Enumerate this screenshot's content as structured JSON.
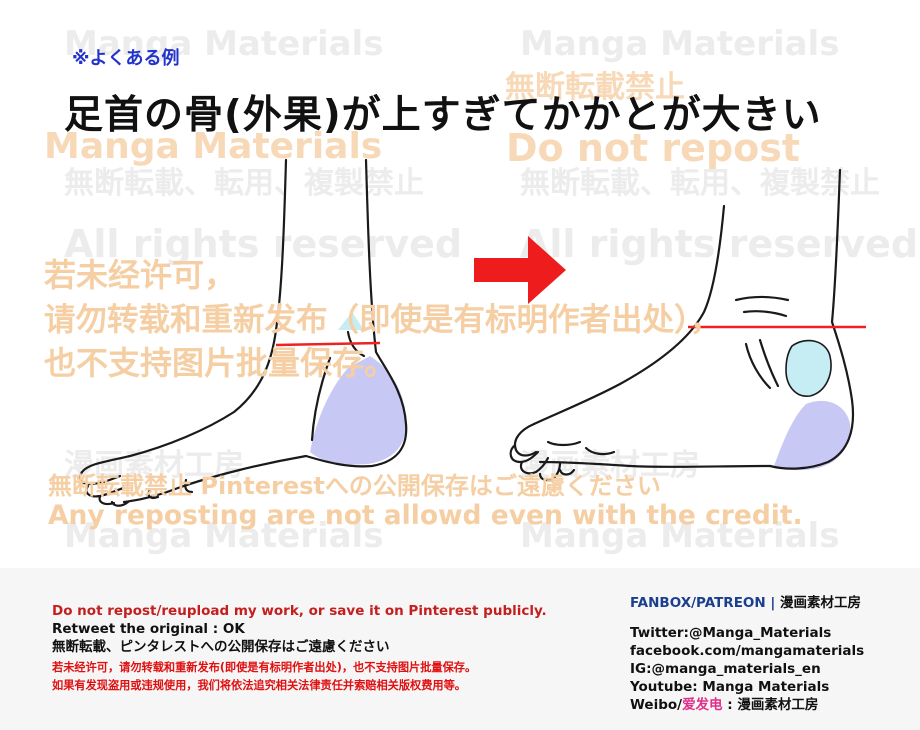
{
  "note": "※よくある例",
  "title": "足首の骨(外果)が上すぎてかかとが大きい",
  "watermarks": {
    "grey": [
      "Manga Materials",
      "Manga Materials",
      "漫画素材工房",
      "無断転載、転用、複製禁止",
      "無断転載、転用、複製禁止",
      "All rights reserved",
      "All rights reserved",
      "漫画素材工房",
      "漫画素材工房",
      "Manga Materials",
      "Manga Materials"
    ],
    "orange": [
      "Manga Materials",
      "無断転載禁止",
      "Do not repost",
      "若未经许可，",
      "请勿转载和重新发布（即使是有标明作者出处），",
      "也不支持图片批量保存。",
      "無断転載禁止 Pinterestへの公開保存はご遠慮ください",
      "Any reposting are not allowd even with the credit."
    ]
  },
  "footer": {
    "line1": "Do not repost/reupload my work, or save it on Pinterest publicly.",
    "line2": "Retweet the original : OK",
    "line3": "無断転載、ピンタレストへの公開保存はご遠慮ください",
    "line4": "若未经许可，请勿转载和重新发布(即使是有标明作者出处)，也不支持图片批量保存。",
    "line5": "如果有发现盗用或违规使用，我们将依法追究相关法律责任并索赔相关版权费用等。",
    "fanbox": "FANBOX/PATREON",
    "fanbox_sep": "|",
    "fanbox_name": "漫画素材工房",
    "twitter": "Twitter:@Manga_Materials",
    "facebook": "facebook.com/mangamaterials",
    "ig": "IG:@manga_materials_en",
    "youtube": "Youtube: Manga Materials",
    "weibo_prefix": "Weibo/",
    "weibo_cn": "爱发电",
    "weibo_suffix": " : 漫画素材工房"
  },
  "colors": {
    "arrow": "#ee1c1c",
    "heel_fill": "#c8c8f4",
    "ankle_fill": "#c6ecf4",
    "guide_line": "#ee2222"
  }
}
